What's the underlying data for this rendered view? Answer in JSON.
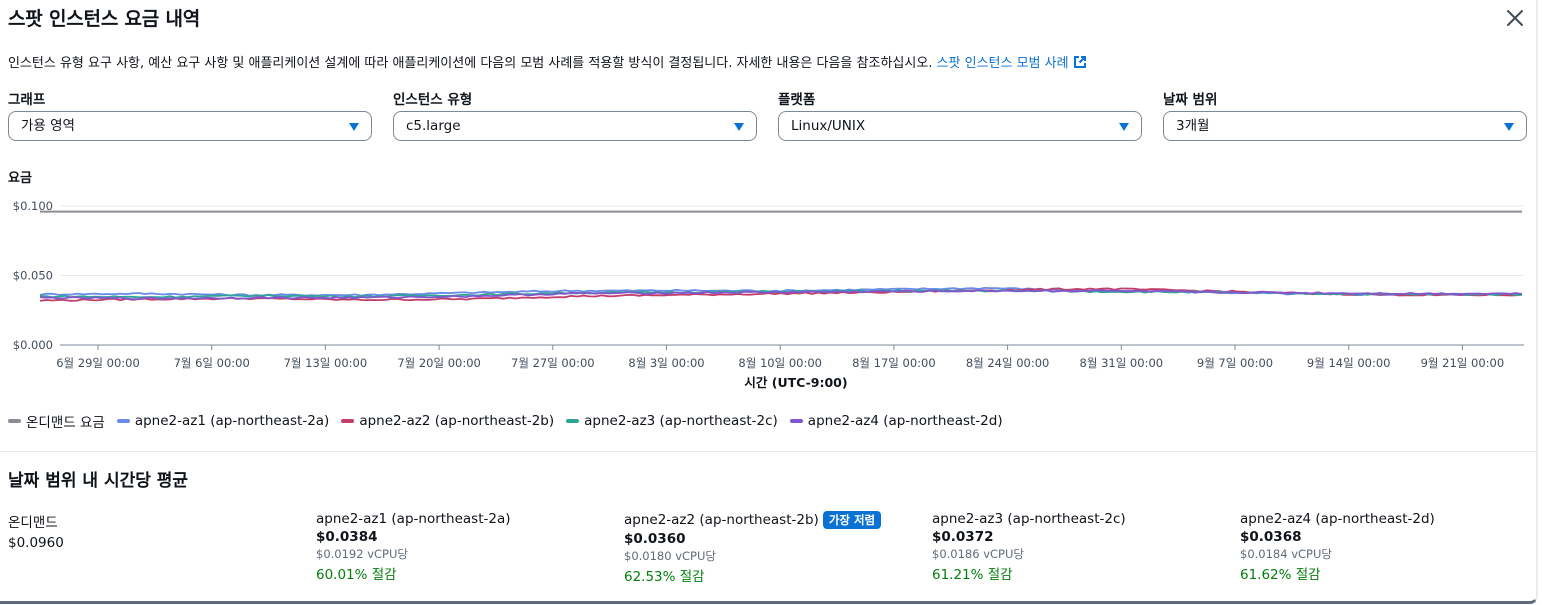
{
  "modal": {
    "title": "스팟 인스턴스 요금 내역",
    "description": "인스턴스 유형 요구 사항, 예산 요구 사항 및 애플리케이션 설계에 따라 애플리케이션에 다음의 모범 사례를 적용할 방식이 결정됩니다. 자세한 내용은 다음을 참조하십시오.",
    "link_text": "스팟 인스턴스 모범 사례"
  },
  "filters": [
    {
      "label": "그래프",
      "value": "가용 영역"
    },
    {
      "label": "인스턴스 유형",
      "value": "c5.large"
    },
    {
      "label": "플랫폼",
      "value": "Linux/UNIX"
    },
    {
      "label": "날짜 범위",
      "value": "3개월"
    }
  ],
  "colors": {
    "on_demand": "#8c8c94",
    "az1": "#688ae8",
    "az2": "#c33d69",
    "az3": "#2ea597",
    "az4": "#8456ce",
    "link": "#0972d3",
    "savings": "#037f0c"
  },
  "chart_data": {
    "type": "line",
    "title": "",
    "ylabel": "요금",
    "xlabel": "시간 (UTC-9:00)",
    "ylim": [
      0,
      0.1
    ],
    "y_ticks": [
      "$0.100",
      "$0.050",
      "$0.000"
    ],
    "x_ticks": [
      "6월 29일 00:00",
      "7월 6일 00:00",
      "7월 13일 00:00",
      "7월 20일 00:00",
      "7월 27일 00:00",
      "8월 3일 00:00",
      "8월 10일 00:00",
      "8월 17일 00:00",
      "8월 24일 00:00",
      "8월 31일 00:00",
      "9월 7일 00:00",
      "9월 14일 00:00",
      "9월 21일 00:00"
    ],
    "x_dates": [
      "6/27",
      "6/29",
      "7/6",
      "7/13",
      "7/20",
      "7/27",
      "8/3",
      "8/10",
      "8/17",
      "8/24",
      "8/31",
      "9/7",
      "9/14",
      "9/21",
      "9/27"
    ],
    "series": [
      {
        "name": "온디맨드 요금",
        "key": "on_demand",
        "values": [
          0.096,
          0.096,
          0.096,
          0.096,
          0.096,
          0.096,
          0.096,
          0.096,
          0.096,
          0.096,
          0.096,
          0.096,
          0.096,
          0.096,
          0.096
        ]
      },
      {
        "name": "apne2-az1 (ap-northeast-2a)",
        "key": "az1",
        "values": [
          0.0365,
          0.037,
          0.036,
          0.036,
          0.0375,
          0.039,
          0.0392,
          0.039,
          0.04,
          0.041,
          0.039,
          0.038,
          0.0365,
          0.0362,
          0.0365
        ]
      },
      {
        "name": "apne2-az2 (ap-northeast-2b)",
        "key": "az2",
        "values": [
          0.032,
          0.033,
          0.0335,
          0.0325,
          0.033,
          0.035,
          0.036,
          0.037,
          0.038,
          0.0395,
          0.0405,
          0.039,
          0.037,
          0.036,
          0.036
        ]
      },
      {
        "name": "apne2-az3 (ap-northeast-2c)",
        "key": "az3",
        "values": [
          0.035,
          0.0345,
          0.0355,
          0.035,
          0.036,
          0.0375,
          0.038,
          0.0385,
          0.039,
          0.039,
          0.0385,
          0.038,
          0.037,
          0.0365,
          0.0365
        ]
      },
      {
        "name": "apne2-az4 (ap-northeast-2d)",
        "key": "az4",
        "values": [
          0.034,
          0.0335,
          0.034,
          0.034,
          0.035,
          0.037,
          0.0375,
          0.038,
          0.0385,
          0.039,
          0.039,
          0.038,
          0.0375,
          0.037,
          0.037
        ]
      }
    ],
    "legend_placement": "bottom-left",
    "grid": true
  },
  "averages": {
    "title": "날짜 범위 내 시간당 평균",
    "on_demand": {
      "name": "온디맨드",
      "price": "$0.0960"
    },
    "zones": [
      {
        "name": "apne2-az1 (ap-northeast-2a)",
        "price": "$0.0384",
        "vcpu": "$0.0192 vCPU당",
        "savings": "60.01% 절감",
        "badge": ""
      },
      {
        "name": "apne2-az2 (ap-northeast-2b)",
        "price": "$0.0360",
        "vcpu": "$0.0180 vCPU당",
        "savings": "62.53% 절감",
        "badge": "가장 저렴"
      },
      {
        "name": "apne2-az3 (ap-northeast-2c)",
        "price": "$0.0372",
        "vcpu": "$0.0186 vCPU당",
        "savings": "61.21% 절감",
        "badge": ""
      },
      {
        "name": "apne2-az4 (ap-northeast-2d)",
        "price": "$0.0368",
        "vcpu": "$0.0184 vCPU당",
        "savings": "61.62% 절감",
        "badge": ""
      }
    ]
  }
}
